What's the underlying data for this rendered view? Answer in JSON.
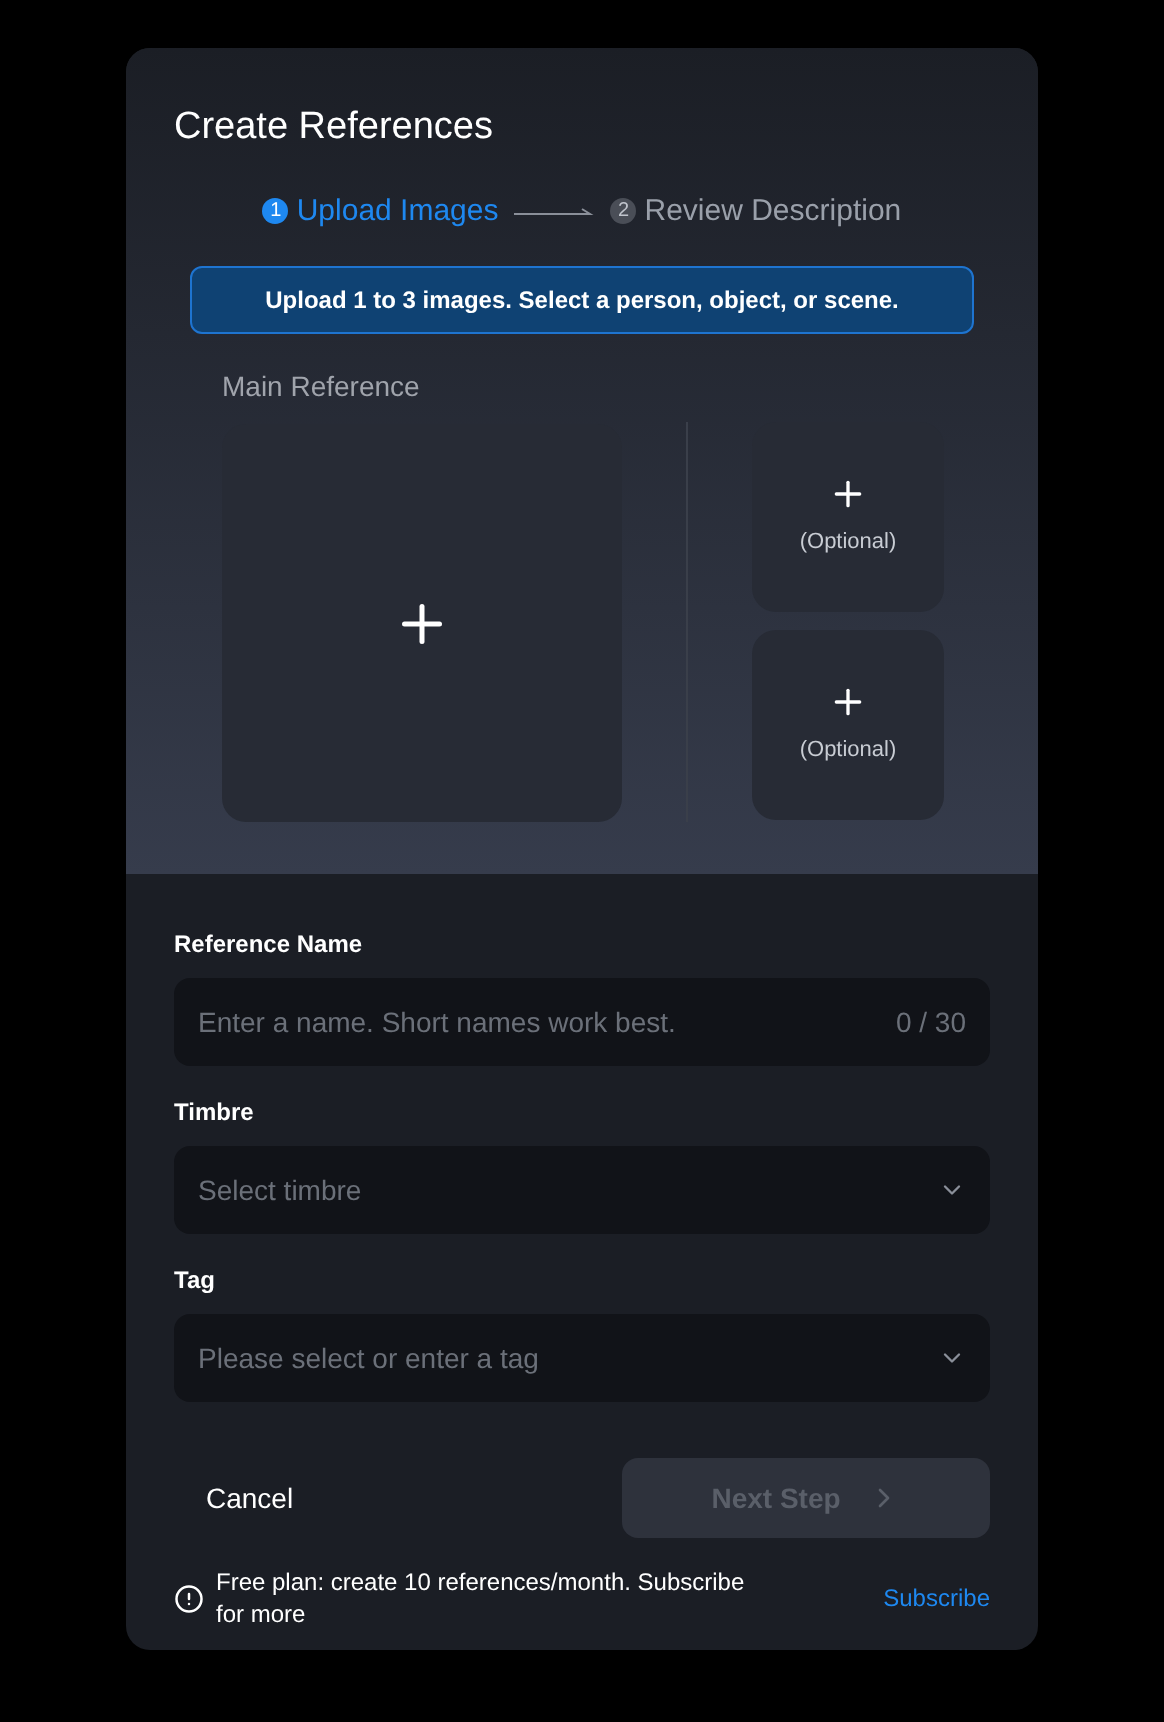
{
  "dialog": {
    "title": "Create References"
  },
  "steps": [
    {
      "number": "1",
      "label": "Upload Images",
      "selected": true
    },
    {
      "number": "2",
      "label": "Review Description",
      "selected": false
    }
  ],
  "banner": "Upload 1 to 3 images. Select a person, object, or scene.",
  "main_reference": {
    "label": "Main Reference"
  },
  "optional_slots": [
    {
      "label": "(Optional)"
    },
    {
      "label": "(Optional)"
    }
  ],
  "fields": [
    {
      "kind": "text",
      "label": "Reference Name",
      "placeholder": "Enter a name. Short names work best.",
      "counter": "0 / 30"
    },
    {
      "kind": "select",
      "label": "Timbre",
      "placeholder": "Select timbre"
    },
    {
      "kind": "select",
      "label": "Tag",
      "placeholder": "Please select or enter a tag"
    }
  ],
  "cancel_button": "Cancel",
  "next_button": {
    "label": "Next Step",
    "disabled": true
  },
  "notice": {
    "text": "Free plan: create 10 references/month. Subscribe for more",
    "link": "Subscribe"
  }
}
